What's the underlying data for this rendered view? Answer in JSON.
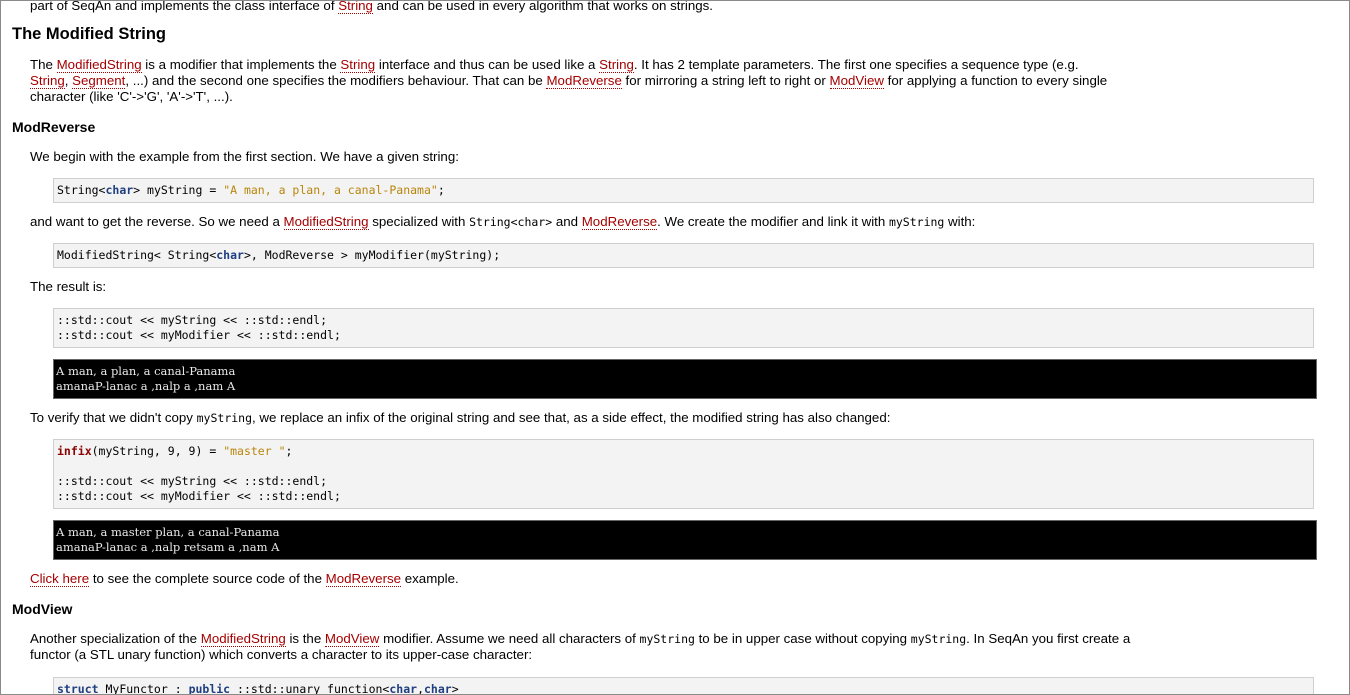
{
  "intro": {
    "t1": "part of SeqAn and implements the class interface of ",
    "link_string": "String",
    "t2": " and can be used in every algorithm that works on strings."
  },
  "section_title": "The Modified String",
  "p1": {
    "t1": "The ",
    "l1": "ModifiedString",
    "t2": " is a modifier that implements the ",
    "l2": "String",
    "t3": " interface and thus can be used like a ",
    "l3": "String",
    "t4": ". It has 2 template parameters. The first one specifies a sequence type (e.g.",
    "l4": "String",
    "t5": ", ",
    "l5": "Segment",
    "t6": ", ...) and the second one specifies the modifiers behaviour. That can be ",
    "l6": "ModReverse",
    "t7": " for mirroring a string left to right or ",
    "l7": "ModView",
    "t8": " for applying a function to every single",
    "t9": "character (like 'C'->'G', 'A'->'T', ...)."
  },
  "modreverse": {
    "title": "ModReverse",
    "p_begin": "We begin with the example from the first section. We have a given string:",
    "code1": {
      "a": "String<",
      "kw": "char",
      "b": "> myString = ",
      "str": "\"A man, a plan, a canal-Panama\"",
      "c": ";"
    },
    "p_want": {
      "t1": "and want to get the reverse. So we need a ",
      "l1": "ModifiedString",
      "t2": " specialized with ",
      "c1": "String<char>",
      "t3": " and ",
      "l2": "ModReverse",
      "t4": ". We create the modifier and link it with ",
      "c2": "myString",
      "t5": " with:"
    },
    "code2": {
      "a": "ModifiedString< String<",
      "kw": "char",
      "b": ">, ModReverse > myModifier(myString);"
    },
    "p_result": "The result is:",
    "code3": "::std::cout << myString << ::std::endl;\n::std::cout << myModifier << ::std::endl;",
    "out1": "A man, a plan, a canal-Panama\namanaP-lanac a ,nalp a ,nam A",
    "p_verify": {
      "t1": "To verify that we didn't copy ",
      "c1": "myString",
      "t2": ", we replace an infix of the original string and see that, as a side effect, the modified string has also changed:"
    },
    "code4": {
      "kw": "infix",
      "a": "(myString, 9, 9) = ",
      "str": "\"master \"",
      "b": ";\n\n::std::cout << myString << ::std::endl;\n::std::cout << myModifier << ::std::endl;"
    },
    "out2": "A man, a master plan, a canal-Panama\namanaP-lanac a ,nalp retsam a ,nam A",
    "p_click": {
      "l1": "Click here",
      "t1": " to see the complete source code of the ",
      "l2": "ModReverse",
      "t2": " example."
    }
  },
  "modview": {
    "title": "ModView",
    "p1": {
      "t1": "Another specialization of the ",
      "l1": "ModifiedString",
      "t2": " is the ",
      "l2": "ModView",
      "t3": " modifier. Assume we need all characters of ",
      "c1": "myString",
      "t4": " to be in upper case without copying ",
      "c2": "myString",
      "t5": ". In SeqAn you first create a",
      "t6": "functor (a STL unary function) which converts a character to its upper-case character:"
    },
    "code5": {
      "kw1": "struct",
      "a": " MyFunctor : ",
      "kw2": "public",
      "b": " ::std::unary_function<",
      "kw3": "char",
      "c": ",",
      "kw4": "char",
      "d": ">"
    }
  }
}
